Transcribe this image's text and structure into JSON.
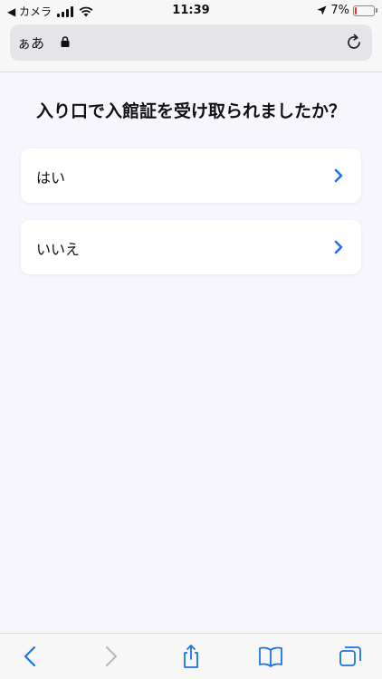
{
  "status_bar": {
    "back_label": "◀ カメラ",
    "time": "11:39",
    "battery_text": "7%",
    "battery_level": 0.07,
    "battery_color": "#e0322d"
  },
  "address_bar": {
    "text_size_label": "ぁあ",
    "icons": [
      "lock-icon",
      "reload-icon"
    ]
  },
  "page": {
    "question": "入り口で入館証を受け取られましたか？",
    "options": [
      {
        "label": "はい"
      },
      {
        "label": "いいえ"
      }
    ],
    "accent_color": "#1a73e8"
  },
  "toolbar": {
    "icons": [
      "back-icon",
      "forward-icon",
      "share-icon",
      "bookmarks-icon",
      "tabs-icon"
    ]
  }
}
